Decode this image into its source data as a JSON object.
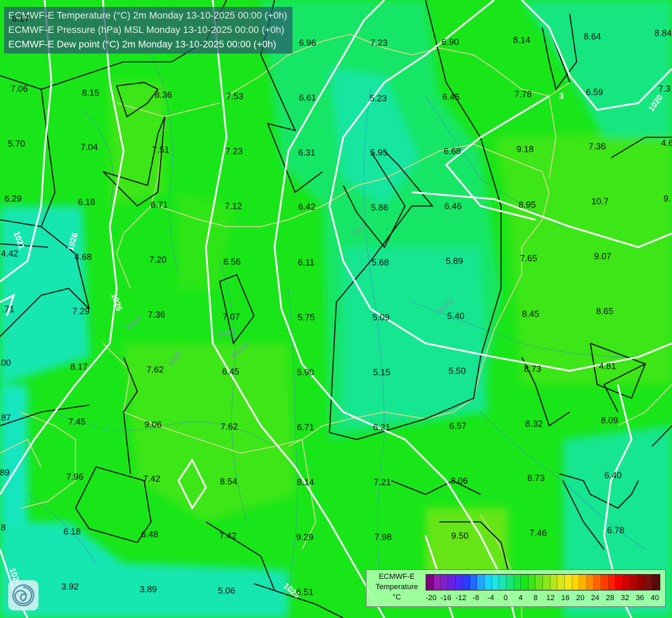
{
  "header": {
    "lines": [
      "ECMWF-E Temperature (°C) 2m Monday 13-10-2025 00:00 (+0h)",
      "ECMWF-E Pressure (hPa) MSL Monday 13-10-2025 00:00 (+0h)",
      "ECMWF-E Dew point (°C) 2m Monday 13-10-2025 00:00 (+0h)"
    ]
  },
  "legend": {
    "title_line1": "ECMWF-E",
    "title_line2": "Temperature",
    "title_line3": "°C",
    "ticks": [
      "-20",
      "-16",
      "-12",
      "-8",
      "-4",
      "0",
      "4",
      "8",
      "12",
      "16",
      "20",
      "24",
      "28",
      "32",
      "36",
      "40"
    ],
    "colors": [
      "#800080",
      "#9b1bb5",
      "#7e22ce",
      "#6a1fe6",
      "#4b2cff",
      "#2a3cff",
      "#1f6bff",
      "#1fa7ff",
      "#19d3ff",
      "#19e6e0",
      "#19e6b0",
      "#19e67a",
      "#19e640",
      "#19e619",
      "#3ce619",
      "#66e619",
      "#8ce619",
      "#b3e619",
      "#d9e619",
      "#f0e619",
      "#ffd700",
      "#ffb000",
      "#ff8c00",
      "#ff6400",
      "#ff3c00",
      "#ff1e00",
      "#f00000",
      "#d20000",
      "#b40000",
      "#960000",
      "#781010",
      "#5a0a0a"
    ]
  },
  "isobars": {
    "labels": [
      "1020",
      "1021",
      "1026",
      "1026",
      "1024",
      "1025",
      "1020",
      "3"
    ]
  },
  "rivers": {
    "labels": [
      "Tisza",
      "Duna",
      "Körös",
      "Maros",
      "Bega",
      "Bega"
    ]
  },
  "values": [
    "6.17",
    "8.15",
    "8.36",
    "7.53",
    "6.96",
    "7.23",
    "6.90",
    "8.14",
    "8.64",
    "8.84",
    "7.06",
    "6.61",
    "5.23",
    "6.45",
    "7.78",
    "6.59",
    "7.3",
    "5.70",
    "7.04",
    "7.51",
    "7.23",
    "6.31",
    "5.95",
    "6.68",
    "9.18",
    "7.36",
    "4.6",
    "6.29",
    "6.18",
    "6.71",
    "7.12",
    "6.42",
    "5.86",
    "6.46",
    "8.95",
    "10.7",
    "9.",
    "4.42",
    "4.68",
    "7.20",
    "6.56",
    "6.11",
    "5.68",
    "5.89",
    "7.65",
    "9.07",
    "7.29",
    "7.36",
    "7.07",
    "5.75",
    "5.09",
    "5.40",
    "8.45",
    "8.65",
    ".71",
    ".00",
    "8.17",
    "7.62",
    "6.45",
    "5.90",
    "5.15",
    "5.50",
    "8.73",
    "4.81",
    ".87",
    "7.45",
    "9.06",
    "7.62",
    "6.71",
    "6.21",
    "6.57",
    "8.32",
    "8.09",
    ".89",
    "7.96",
    "7.42",
    "8.54",
    "8.14",
    "7.21",
    "8.06",
    "8.73",
    "6.40",
    ".8",
    "6.18",
    "6.48",
    "7.42",
    "9.29",
    "7.98",
    "9.50",
    "7.46",
    "6.78",
    "3.92",
    "3.89",
    "5.06",
    "6.51"
  ]
}
